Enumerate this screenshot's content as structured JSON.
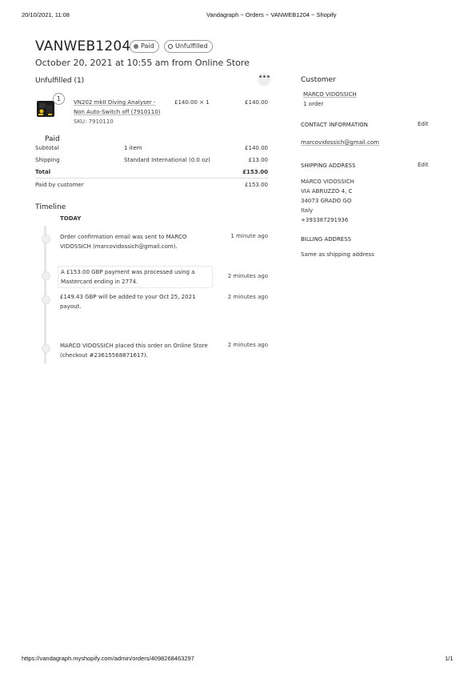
{
  "print": {
    "datetime": "20/10/2021, 11:08",
    "doc_title": "Vandagraph ~ Orders ~ VANWEB1204 ~ Shopify",
    "url": "https://vandagraph.myshopify.com/admin/orders/4098268463297",
    "page": "1/1"
  },
  "order": {
    "number": "VANWEB1204",
    "payment_badge": "Paid",
    "fulfillment_badge": "Unfulfilled",
    "subtitle": "October 20, 2021 at 10:55 am from Online Store"
  },
  "unfulfilled": {
    "heading": "Unfulfilled (1)",
    "more": "•••",
    "item": {
      "qty_badge": "1",
      "name_line1": "VN202 mkII Diving Analyser -",
      "name_line2": "Non Auto-Switch off (7910110)",
      "sku": "SKU: 7910110",
      "unit_price": "£140.00 × 1",
      "total": "£140.00"
    }
  },
  "paid": {
    "heading": "Paid",
    "rows": [
      {
        "label": "Subtotal",
        "detail": "1 item",
        "amount": "£140.00"
      },
      {
        "label": "Shipping",
        "detail": "Standard International (0.0 oz)",
        "amount": "£13.00"
      },
      {
        "label": "Total",
        "detail": "",
        "amount": "£153.00"
      }
    ],
    "paid_by_customer": {
      "label": "Paid by customer",
      "amount": "£153.00"
    }
  },
  "timeline": {
    "heading": "Timeline",
    "today": "TODAY",
    "events": [
      {
        "line1": "Order confirmation email was sent to MARCO",
        "line2": "VIDOSSICH (marcovidossich@gmail.com).",
        "time": "1 minute ago"
      },
      {
        "line1": "A £153.00 GBP payment was processed using a",
        "line2": "Mastercard ending in 2774.",
        "time": "2 minutes ago"
      },
      {
        "line1": "£149.43 GBP will be added to your Oct 25, 2021",
        "line2": "payout.",
        "time": "2 minutes ago"
      },
      {
        "line1": "MARCO VIDOSSICH placed this order on Online Store",
        "line2": "(checkout #23615568871617).",
        "time": "2 minutes ago"
      }
    ]
  },
  "customer": {
    "heading": "Customer",
    "name": "MARCO VIDOSSICH",
    "orders": "1 order",
    "contact_heading": "CONTACT INFORMATION",
    "contact_edit": "Edit",
    "email": "marcovidossich@gmail.com",
    "shipping_heading": "SHIPPING ADDRESS",
    "shipping_edit": "Edit",
    "address": [
      "MARCO VIDOSSICH",
      "VIA ABRUZZO 4, C",
      "34073 GRADO GO",
      "Italy",
      "+393387291936"
    ],
    "billing_heading": "BILLING ADDRESS",
    "billing_text": "Same as shipping address"
  },
  "icons": {
    "more": "ellipsis-icon",
    "product": "product-thumbnail",
    "paid_dot": "filled-dot-icon",
    "unfulfilled_dot": "ring-dot-icon"
  }
}
